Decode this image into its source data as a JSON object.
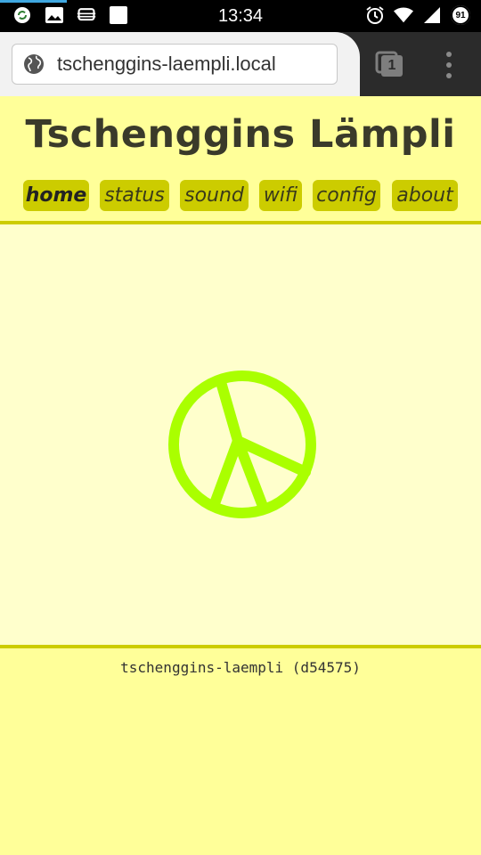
{
  "statusbar": {
    "time": "13:34",
    "battery_level": "91",
    "left_icons": [
      "sync-icon",
      "image-icon",
      "cast-icon",
      "square-icon"
    ],
    "right_icons": [
      "alarm-icon",
      "wifi-icon",
      "signal-icon",
      "battery-icon"
    ]
  },
  "browser": {
    "url": "tschenggins-laempli.local",
    "tab_count": "1",
    "accent": "#3fa7e0"
  },
  "site": {
    "title": "Tschenggins Lämpli",
    "nav": [
      {
        "label": "home",
        "active": true
      },
      {
        "label": "status",
        "active": false
      },
      {
        "label": "sound",
        "active": false
      },
      {
        "label": "wifi",
        "active": false
      },
      {
        "label": "config",
        "active": false
      },
      {
        "label": "about",
        "active": false
      }
    ],
    "main_icon": "peace-sign-icon",
    "footer": "tschenggins-laempli (d54575)"
  },
  "colors": {
    "header_bg": "#ffff99",
    "content_bg": "#ffffcc",
    "nav_bg": "#cccc00",
    "divider": "#cccc00",
    "peace_sign": "#aaff00"
  }
}
